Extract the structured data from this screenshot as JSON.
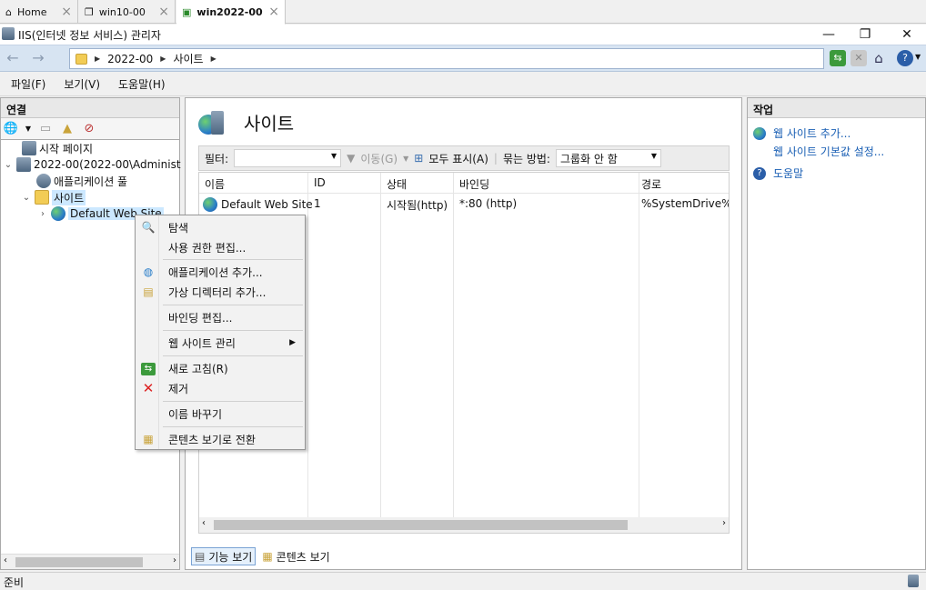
{
  "tabs": [
    {
      "label": "Home",
      "icon": "home-icon"
    },
    {
      "label": "win10-00",
      "icon": "vm-icon"
    },
    {
      "label": "win2022-00",
      "icon": "vm-running-icon"
    }
  ],
  "window": {
    "title": "IIS(인터넷 정보 서비스) 관리자"
  },
  "address": {
    "segments": [
      "2022-00",
      "사이트"
    ]
  },
  "menu": [
    "파일(F)",
    "보기(V)",
    "도움말(H)"
  ],
  "connections": {
    "title": "연결",
    "tree": [
      {
        "label": "시작 페이지"
      },
      {
        "label": "2022-00(2022-00\\Administ"
      },
      {
        "label": "애플리케이션 풀"
      },
      {
        "label": "사이트"
      },
      {
        "label": "Default Web Site"
      }
    ]
  },
  "main": {
    "title": "사이트",
    "filter_label": "필터:",
    "go_label": "이동(G)",
    "show_all_label": "모두 표시(A)",
    "group_by_label": "묶는 방법:",
    "group_by_value": "그룹화 안 함",
    "columns": [
      "이름",
      "ID",
      "상태",
      "바인딩",
      "경로"
    ],
    "rows": [
      {
        "name": "Default Web Site",
        "id": "1",
        "status": "시작됨(http)",
        "binding": "*:80 (http)",
        "path": "%SystemDrive%\\"
      }
    ],
    "feature_view": "기능 보기",
    "content_view": "콘텐츠 보기"
  },
  "actions": {
    "title": "작업",
    "items": [
      "웹 사이트 추가...",
      "웹 사이트 기본값 설정...",
      "도움말"
    ]
  },
  "status": {
    "text": "준비"
  },
  "context_menu": {
    "items": [
      "탐색",
      "사용 권한 편집...",
      "애플리케이션 추가...",
      "가상 디렉터리 추가...",
      "바인딩 편집...",
      "웹 사이트 관리",
      "새로 고침(R)",
      "제거",
      "이름 바꾸기",
      "콘텐츠 보기로 전환"
    ]
  },
  "colors": {
    "accent": "#1a5fb4",
    "selection": "#cce8ff",
    "address_bar": "#d7e4f2"
  }
}
